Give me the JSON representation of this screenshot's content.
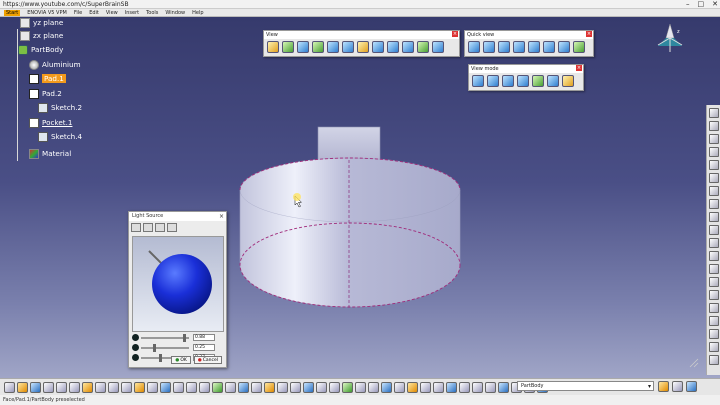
{
  "window": {
    "title": "https://www.youtube.com/c/SuperBrainSB"
  },
  "menu": {
    "items": [
      "Start",
      "ENOVIA V5 VPM",
      "File",
      "Edit",
      "View",
      "Insert",
      "Tools",
      "Window",
      "Help"
    ]
  },
  "tree": {
    "items": [
      {
        "label": "yz plane",
        "icon": "plane-icon"
      },
      {
        "label": "zx plane",
        "icon": "plane-icon"
      },
      {
        "label": "PartBody",
        "icon": "partbody-icon"
      },
      {
        "label": "Aluminium",
        "icon": "material-sphere-icon"
      },
      {
        "label": "Pad.1",
        "icon": "pad-icon"
      },
      {
        "label": "Pad.2",
        "icon": "pad-icon"
      },
      {
        "label": "Sketch.2",
        "icon": "sketch-icon"
      },
      {
        "label": "Pocket.1",
        "icon": "pocket-icon"
      },
      {
        "label": "Sketch.4",
        "icon": "sketch-icon"
      },
      {
        "label": "Material",
        "icon": "material-icon"
      }
    ]
  },
  "toolbars": {
    "view": {
      "title": "View"
    },
    "quick_view": {
      "title": "Quick view"
    },
    "view_mode": {
      "title": "View mode"
    }
  },
  "light_source": {
    "title": "Light Source",
    "values": [
      "0.88",
      "0.25",
      "0.37"
    ],
    "ok": "OK",
    "cancel": "Cancel"
  },
  "bottom": {
    "combo_value": "PartBody"
  },
  "status": {
    "text": "Face/Pad.1/PartBody preselected"
  },
  "colors": {
    "selection": "#f39a1c",
    "background_top": "#34386a",
    "background_bottom": "#aeb3d0"
  }
}
